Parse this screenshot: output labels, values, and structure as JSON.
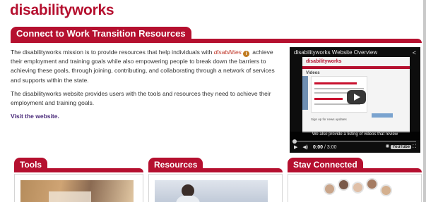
{
  "site": {
    "logo": "disabilityworks"
  },
  "section": {
    "title": "Connect to Work Transition Resources"
  },
  "intro": {
    "p1_a": "The disabilityworks mission is to provide resources that help individuals with ",
    "p1_link": "disabilities",
    "p1_b": " achieve their employment and training goals while also empowering people to break down the barriers to achieving these goals, through joining, contributing, and collaborating through a network of services and supports within the state.",
    "p2": "The disabilityworks website provides users with the tools and resources they need to achieve their employment and training goals.",
    "visit": "Visit the website."
  },
  "video": {
    "title": "disabilityworks Website Overview",
    "thumb_brand": "disabilityworks",
    "thumb_section": "Videos",
    "thumb_signup": "Sign up for news updates",
    "caption": "We also provide a listing of videos that review",
    "time_current": "0:00",
    "time_total": "3:00",
    "youtube_label": "YouTube",
    "icons": [
      "share-icon",
      "play-icon",
      "volume-icon",
      "settings-icon",
      "fullscreen-icon"
    ]
  },
  "cards": [
    {
      "title": "Tools"
    },
    {
      "title": "Resources"
    },
    {
      "title": "Stay Connected"
    }
  ],
  "colors": {
    "brand": "#b5102f",
    "link_purple": "#4a2a7a"
  }
}
